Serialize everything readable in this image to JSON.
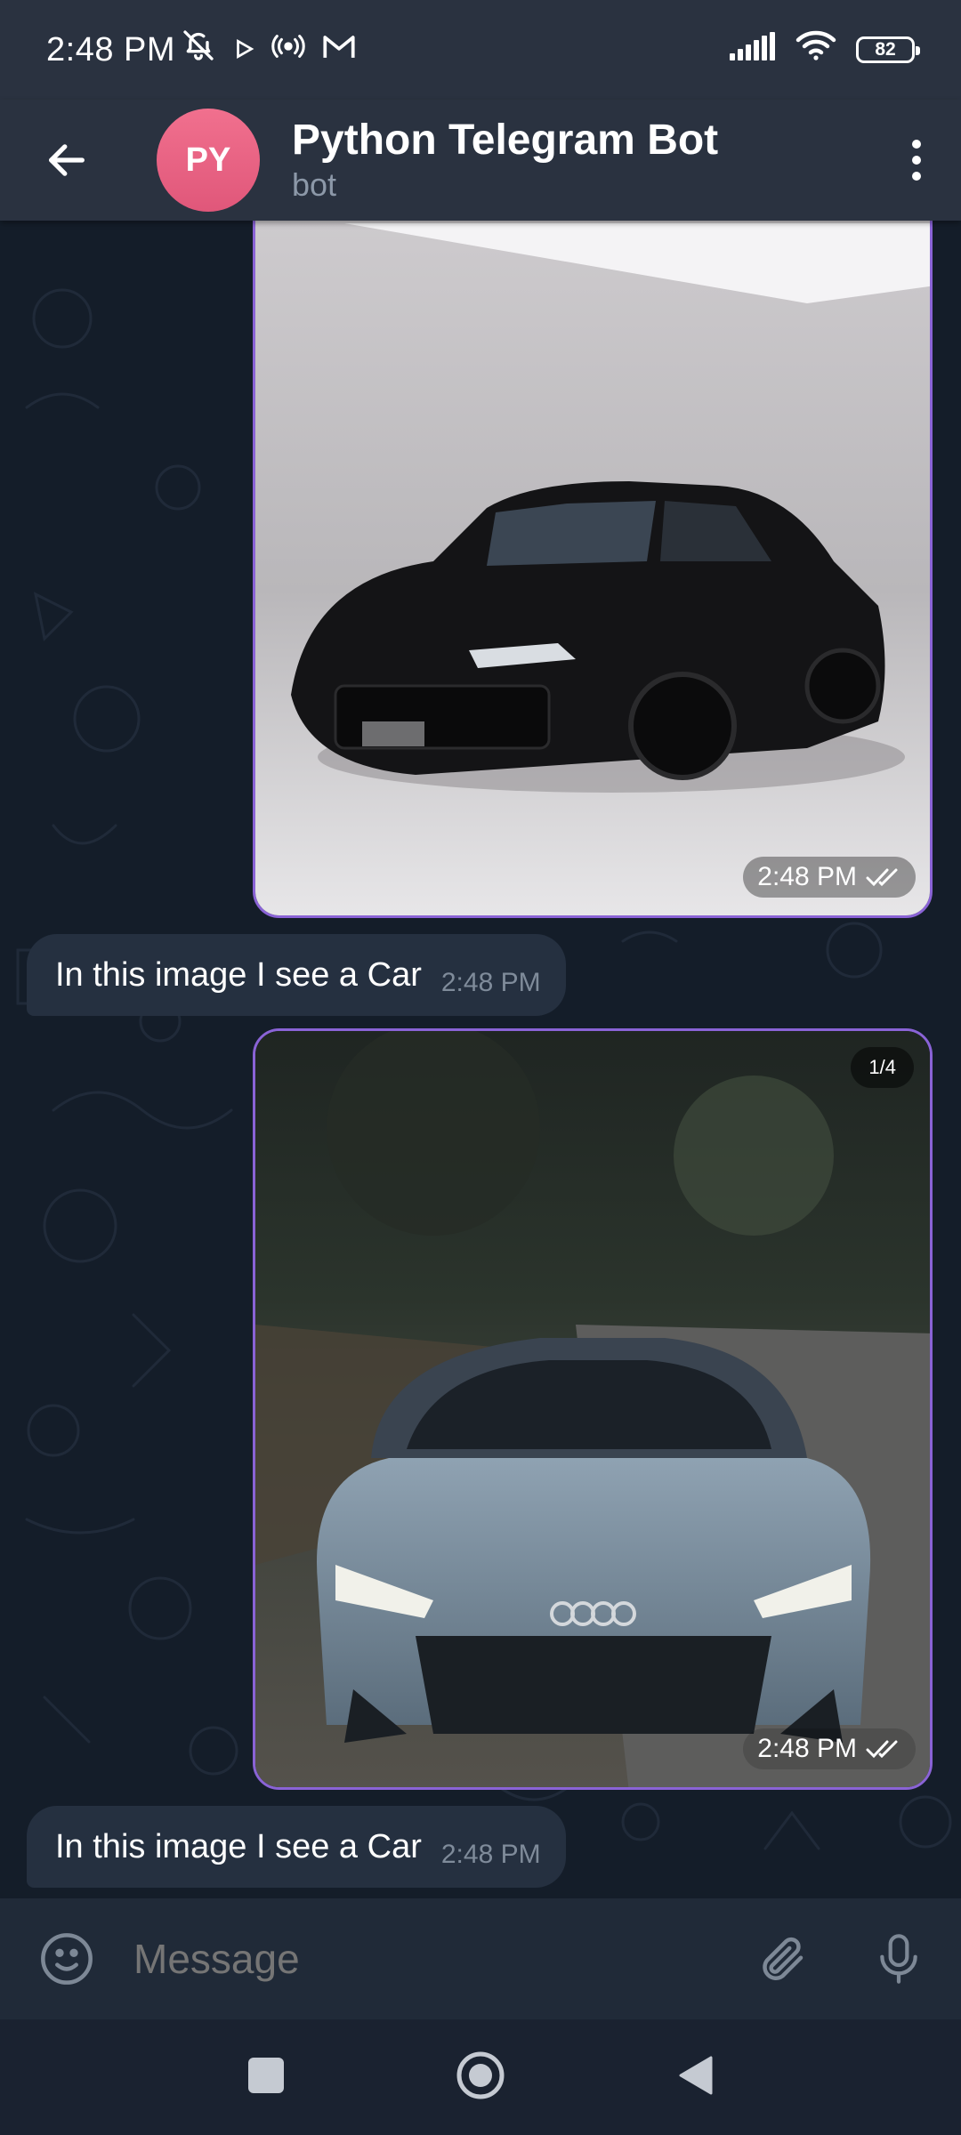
{
  "status_bar": {
    "time": "2:48 PM",
    "battery": "82",
    "icons": [
      "mute-icon",
      "play-icon",
      "hotspot-icon",
      "gmail-icon",
      "signal-icon",
      "wifi-icon",
      "battery-icon"
    ]
  },
  "header": {
    "avatar_initials": "PY",
    "title": "Python Telegram Bot",
    "subtitle": "bot",
    "avatar_color": "#e8607f"
  },
  "messages": [
    {
      "type": "photo",
      "subject": "black-wagon-car",
      "time": "2:48 PM",
      "status": "read"
    },
    {
      "type": "text",
      "text": "In this image I see a Car",
      "time": "2:48 PM"
    },
    {
      "type": "photo",
      "subject": "blue-grey-sports-car",
      "time": "2:48 PM",
      "status": "read",
      "counter": "1/4"
    },
    {
      "type": "text",
      "text": "In this image I see a Car",
      "time": "2:48 PM"
    }
  ],
  "input": {
    "placeholder": "Message"
  },
  "colors": {
    "accent_border": "#8a63d6",
    "bubble_in": "#253040",
    "background": "#141d29"
  }
}
